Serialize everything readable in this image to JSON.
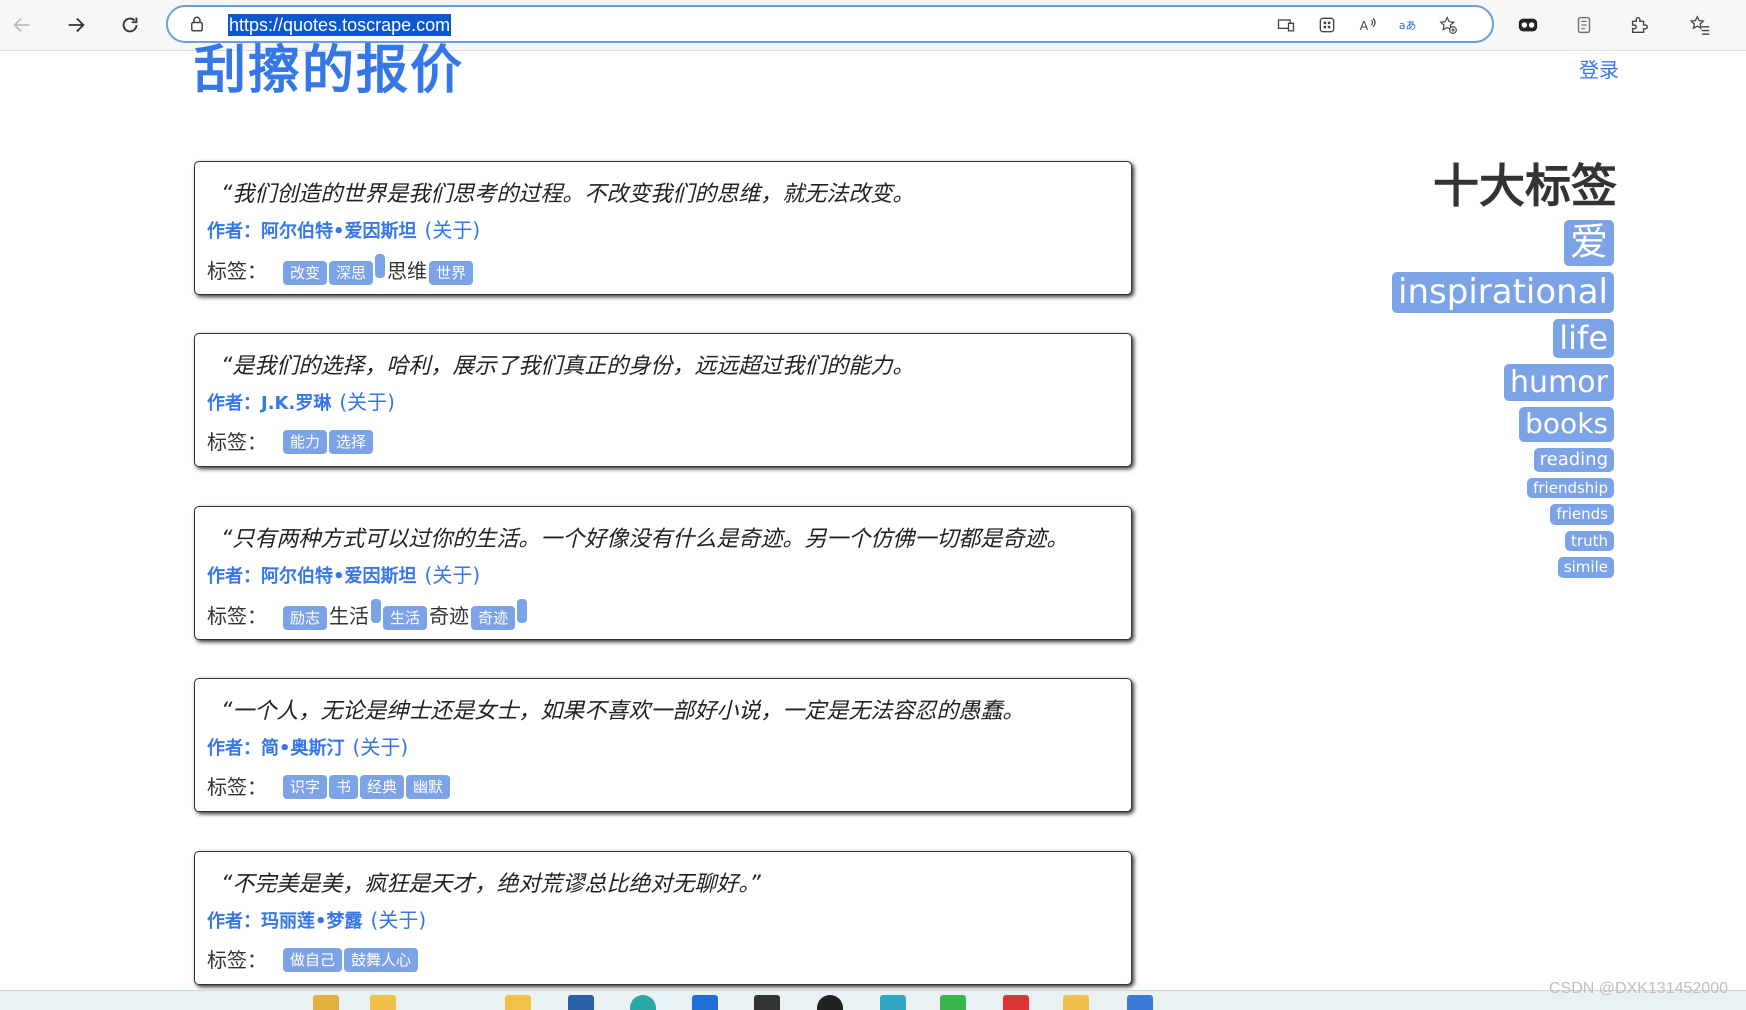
{
  "browser": {
    "url": "https://quotes.toscrape.com"
  },
  "site": {
    "title": "刮擦的报价",
    "login_label": "登录"
  },
  "quotes": [
    {
      "text": "“我们创造的世界是我们思考的过程。不改变我们的思维，就无法改变。",
      "author_prefix": "作者：",
      "author": "阿尔伯特•爱因斯坦",
      "about": "(关于)",
      "tags_label": "标签：",
      "tags": [
        {
          "kind": "tag",
          "text": "改变"
        },
        {
          "kind": "tag",
          "text": "深思"
        },
        {
          "kind": "blank"
        },
        {
          "kind": "word",
          "text": "思维"
        },
        {
          "kind": "tag",
          "text": "世界"
        }
      ]
    },
    {
      "text": "“是我们的选择，哈利，展示了我们真正的身份，远远超过我们的能力。",
      "author_prefix": "作者：",
      "author": "J.K.罗琳",
      "about": "(关于)",
      "tags_label": "标签：",
      "tags": [
        {
          "kind": "tag",
          "text": "能力"
        },
        {
          "kind": "tag",
          "text": "选择"
        }
      ]
    },
    {
      "text": "“只有两种方式可以过你的生活。一个好像没有什么是奇迹。另一个仿佛一切都是奇迹。",
      "author_prefix": "作者：",
      "author": "阿尔伯特•爱因斯坦",
      "about": "(关于)",
      "tags_label": "标签：",
      "tags": [
        {
          "kind": "tag",
          "text": "励志"
        },
        {
          "kind": "word",
          "text": "生活"
        },
        {
          "kind": "blank"
        },
        {
          "kind": "tag",
          "text": "生活"
        },
        {
          "kind": "word",
          "text": "奇迹"
        },
        {
          "kind": "tag",
          "text": "奇迹"
        },
        {
          "kind": "blank"
        }
      ]
    },
    {
      "text": "“一个人，无论是绅士还是女士，如果不喜欢一部好小说，一定是无法容忍的愚蠢。",
      "author_prefix": "作者：",
      "author": "简•奥斯汀",
      "about": "(关于)",
      "tags_label": "标签：",
      "tags": [
        {
          "kind": "tag",
          "text": "识字"
        },
        {
          "kind": "tag",
          "text": "书"
        },
        {
          "kind": "tag",
          "text": "经典"
        },
        {
          "kind": "tag",
          "text": "幽默"
        }
      ]
    },
    {
      "text": "“不完美是美，疯狂是天才，绝对荒谬总比绝对无聊好。”",
      "author_prefix": "作者：",
      "author": "玛丽莲•梦露",
      "about": "(关于)",
      "tags_label": "标签：",
      "tags": [
        {
          "kind": "tag",
          "text": "做自己"
        },
        {
          "kind": "tag",
          "text": "鼓舞人心"
        }
      ]
    }
  ],
  "sidebar": {
    "title": "十大标签",
    "top_tags": [
      {
        "text": "爱",
        "size": 38
      },
      {
        "text": "inspirational",
        "size": 34
      },
      {
        "text": "life",
        "size": 32
      },
      {
        "text": "humor",
        "size": 30
      },
      {
        "text": "books",
        "size": 28
      },
      {
        "text": "reading",
        "size": 18
      },
      {
        "text": "friendship",
        "size": 15
      },
      {
        "text": "friends",
        "size": 15
      },
      {
        "text": "truth",
        "size": 15
      },
      {
        "text": "simile",
        "size": 15
      }
    ]
  },
  "watermark": "CSDN @DXK131452000",
  "colors": {
    "link": "#3677e8",
    "tag_bg": "#7ca3e6",
    "url_highlight": "#0b57d0"
  }
}
